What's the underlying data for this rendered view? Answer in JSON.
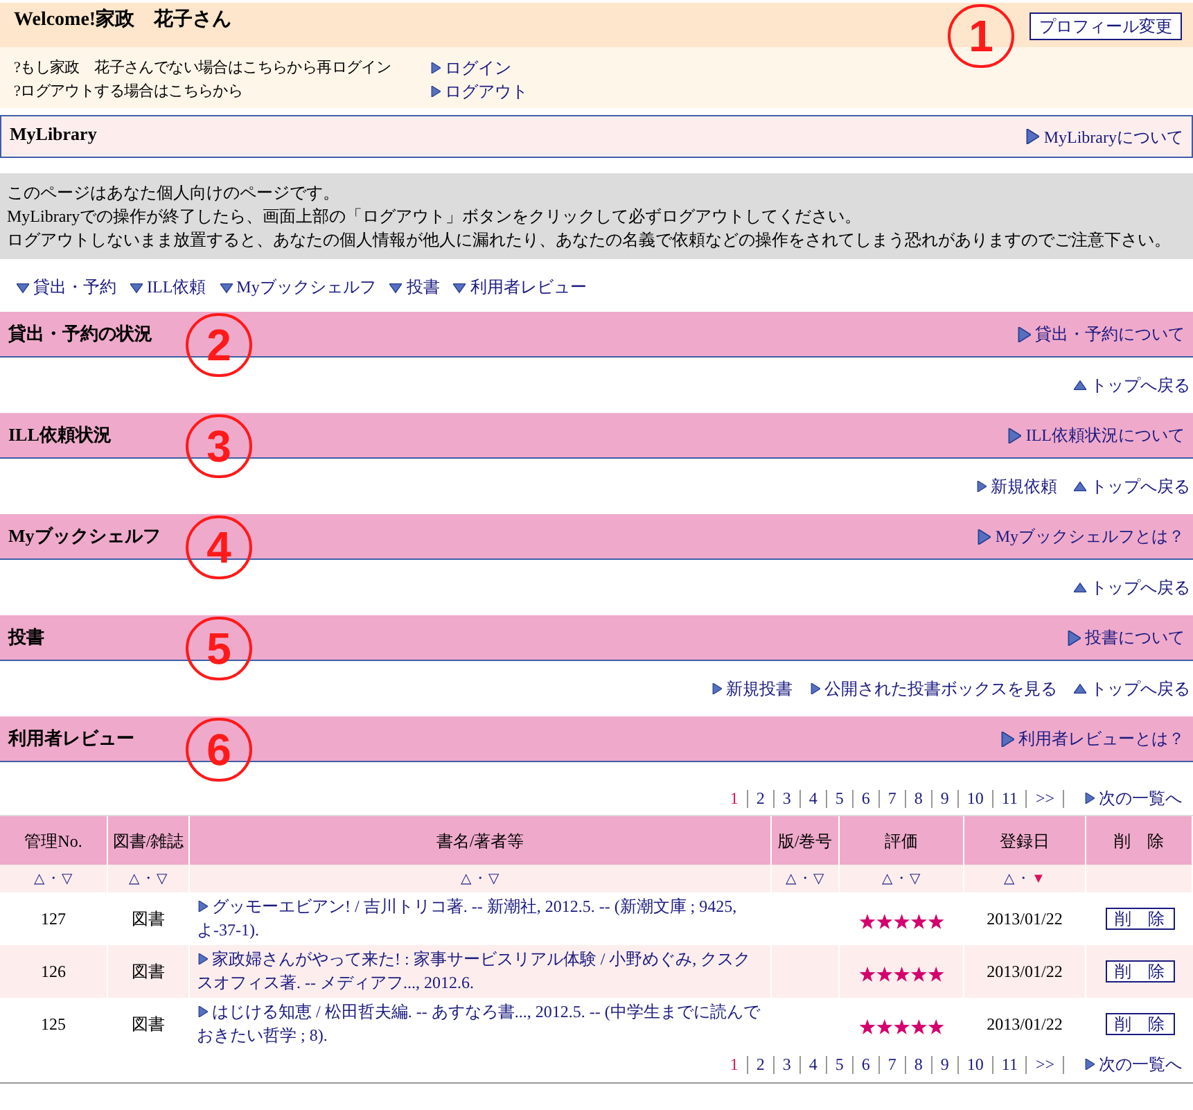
{
  "header": {
    "welcome": "Welcome!家政　花子さん",
    "callout": "1",
    "profile_button": "プロフィール変更"
  },
  "login_lines": [
    {
      "note": "?もし家政　花子さんでない場合はこちらから再ログイン",
      "link": "ログイン"
    },
    {
      "note": "?ログアウトする場合はこちらから",
      "link": "ログアウト"
    }
  ],
  "mylibrary": {
    "title": "MyLibrary",
    "link": "MyLibraryについて"
  },
  "notice": [
    "このページはあなた個人向けのページです。",
    "MyLibraryでの操作が終了したら、画面上部の「ログアウト」ボタンをクリックして必ずログアウトしてください。",
    "ログアウトしないまま放置すると、あなたの個人情報が他人に漏れたり、あなたの名義で依頼などの操作をされてしまう恐れがありますのでご注意下さい。"
  ],
  "nav": [
    "貸出・予約",
    "ILL依頼",
    "Myブックシェルフ",
    "投書",
    "利用者レビュー"
  ],
  "sections": [
    {
      "title": "貸出・予約の状況",
      "link": "貸出・予約について",
      "callout": "2",
      "actions": [
        {
          "kind": "top",
          "label": "トップへ戻る"
        }
      ]
    },
    {
      "title": "ILL依頼状況",
      "link": "ILL依頼状況について",
      "callout": "3",
      "actions": [
        {
          "kind": "link",
          "label": "新規依頼"
        },
        {
          "kind": "top",
          "label": "トップへ戻る"
        }
      ]
    },
    {
      "title": "Myブックシェルフ",
      "link": "Myブックシェルフとは？",
      "callout": "4",
      "actions": [
        {
          "kind": "top",
          "label": "トップへ戻る"
        }
      ]
    },
    {
      "title": "投書",
      "link": "投書について",
      "callout": "5",
      "actions": [
        {
          "kind": "link",
          "label": "新規投書"
        },
        {
          "kind": "link",
          "label": "公開された投書ボックスを見る"
        },
        {
          "kind": "top",
          "label": "トップへ戻る"
        }
      ]
    },
    {
      "title": "利用者レビュー",
      "link": "利用者レビューとは？",
      "callout": "6"
    }
  ],
  "pagination_top": {
    "pages": [
      {
        "label": "1",
        "selected": true
      },
      {
        "label": "2",
        "selected": false
      },
      {
        "label": "3",
        "selected": false
      },
      {
        "label": "4",
        "selected": false
      },
      {
        "label": "5",
        "selected": false
      },
      {
        "label": "6",
        "selected": false
      },
      {
        "label": "7",
        "selected": false
      },
      {
        "label": "8",
        "selected": false
      },
      {
        "label": "9",
        "selected": false
      },
      {
        "label": "10",
        "selected": false
      },
      {
        "label": "11",
        "selected": false
      },
      {
        "label": ">>",
        "selected": false
      }
    ],
    "next": "次の一覧へ"
  },
  "table": {
    "columns": [
      {
        "label": "管理No.",
        "sort_up": "△",
        "sort_sep": "・",
        "sort_down": "▽",
        "sort_up_selected": false,
        "sort_down_selected": false
      },
      {
        "label": "図書/雑誌",
        "sort_up": "△",
        "sort_sep": "・",
        "sort_down": "▽",
        "sort_up_selected": false,
        "sort_down_selected": false
      },
      {
        "label": "書名/著者等",
        "sort_up": "△",
        "sort_sep": "・",
        "sort_down": "▽",
        "sort_up_selected": false,
        "sort_down_selected": false
      },
      {
        "label": "版/巻号",
        "sort_up": "△",
        "sort_sep": "・",
        "sort_down": "▽",
        "sort_up_selected": false,
        "sort_down_selected": false
      },
      {
        "label": "評価",
        "sort_up": "△",
        "sort_sep": "・",
        "sort_down": "▽",
        "sort_up_selected": false,
        "sort_down_selected": false
      },
      {
        "label": "登録日",
        "sort_up": "△",
        "sort_sep": "・",
        "sort_down": "▼",
        "sort_up_selected": false,
        "sort_down_selected": true
      },
      {
        "label": "削　除"
      }
    ],
    "rows": [
      {
        "no": "127",
        "type": "図書",
        "title": "グッモーエビアン! / 吉川トリコ著. -- 新潮社, 2012.5. -- (新潮文庫 ; 9425, よ-37-1).",
        "stars": 5,
        "date": "2013/01/22",
        "delete": "削　除"
      },
      {
        "no": "126",
        "type": "図書",
        "title": "家政婦さんがやって来た! : 家事サービスリアル体験 / 小野めぐみ, クスクスオフィス著. -- メディアフ..., 2012.6.",
        "stars": 5,
        "date": "2013/01/22",
        "delete": "削　除"
      },
      {
        "no": "125",
        "type": "図書",
        "title": "はじける知恵 / 松田哲夫編. -- あすなろ書..., 2012.5. -- (中学生までに読んでおきたい哲学 ; 8).",
        "stars": 5,
        "date": "2013/01/22",
        "delete": "削　除"
      }
    ]
  },
  "pagination_bottom": {
    "pages": [
      {
        "label": "1",
        "selected": true
      },
      {
        "label": "2",
        "selected": false
      },
      {
        "label": "3",
        "selected": false
      },
      {
        "label": "4",
        "selected": false
      },
      {
        "label": "5",
        "selected": false
      },
      {
        "label": "6",
        "selected": false
      },
      {
        "label": "7",
        "selected": false
      },
      {
        "label": "8",
        "selected": false
      },
      {
        "label": "9",
        "selected": false
      },
      {
        "label": "10",
        "selected": false
      },
      {
        "label": "11",
        "selected": false
      },
      {
        "label": ">>",
        "selected": false
      }
    ],
    "next": "次の一覧へ"
  }
}
